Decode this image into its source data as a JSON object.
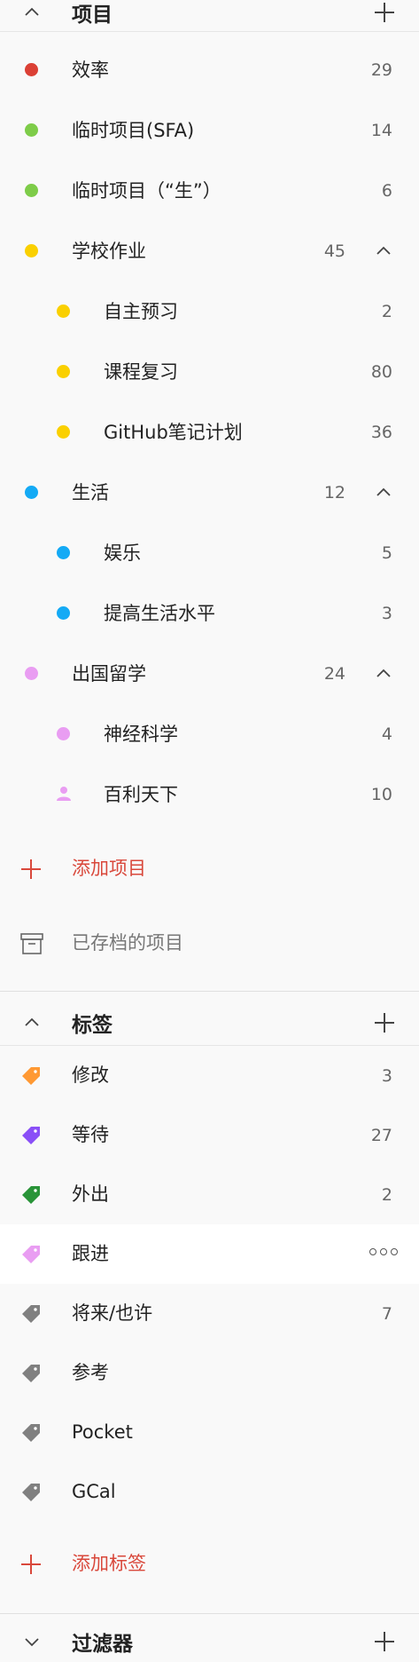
{
  "projects": {
    "title": "项目",
    "add_label": "添加项目",
    "archived_label": "已存档的项目",
    "items": [
      {
        "label": "效率",
        "count": "29",
        "color": "#db4035"
      },
      {
        "label": "临时项目(SFA)",
        "count": "14",
        "color": "#7ecc49"
      },
      {
        "label": "临时项目（“生”）",
        "count": "6",
        "color": "#7ecc49"
      },
      {
        "label": "学校作业",
        "count": "45",
        "color": "#fad000"
      },
      {
        "label": "自主预习",
        "count": "2",
        "color": "#fad000"
      },
      {
        "label": "课程复习",
        "count": "80",
        "color": "#fad000"
      },
      {
        "label": "GitHub笔记计划",
        "count": "36",
        "color": "#fad000"
      },
      {
        "label": "生活",
        "count": "12",
        "color": "#14aaf5"
      },
      {
        "label": "娱乐",
        "count": "5",
        "color": "#14aaf5"
      },
      {
        "label": "提高生活水平",
        "count": "3",
        "color": "#14aaf5"
      },
      {
        "label": "出国留学",
        "count": "24",
        "color": "#e99df2"
      },
      {
        "label": "神经科学",
        "count": "4",
        "color": "#e99df2"
      },
      {
        "label": "百利天下",
        "count": "10",
        "color": "#e99df2",
        "icon": "person-icon"
      }
    ]
  },
  "labels": {
    "title": "标签",
    "add_label": "添加标签",
    "items": [
      {
        "label": "修改",
        "count": "3",
        "color": "#ff9933"
      },
      {
        "label": "等待",
        "count": "27",
        "color": "#8a4ff7"
      },
      {
        "label": "外出",
        "count": "2",
        "color": "#299438"
      },
      {
        "label": "跟进",
        "count": "",
        "color": "#e99df2",
        "more_icon": "more-options-icon"
      },
      {
        "label": "将来/也许",
        "count": "7",
        "color": "#808080"
      },
      {
        "label": "参考",
        "count": "",
        "color": "#808080"
      },
      {
        "label": "Pocket",
        "count": "",
        "color": "#808080"
      },
      {
        "label": "GCal",
        "count": "",
        "color": "#808080"
      }
    ]
  },
  "filters": {
    "title": "过滤器"
  }
}
